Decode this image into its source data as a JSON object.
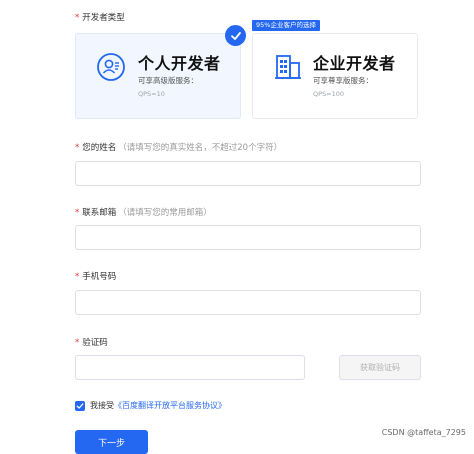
{
  "developer_type": {
    "label": "开发者类型",
    "required_mark": "*",
    "promo_tag": "95%企业客户的选择",
    "cards": [
      {
        "title": "个人开发者",
        "desc": "可享高级版服务：",
        "qps": "QPS=10",
        "icon": "person-icon",
        "selected": true
      },
      {
        "title": "企业开发者",
        "desc": "可享尊享版服务：",
        "qps": "QPS=100",
        "icon": "building-icon",
        "selected": false
      }
    ]
  },
  "form": {
    "name": {
      "label": "您的姓名",
      "hint": "（请填写您的真实姓名，不超过20个字符）",
      "value": ""
    },
    "email": {
      "label": "联系邮箱",
      "hint": "（请填写您的常用邮箱）",
      "value": ""
    },
    "phone": {
      "label": "手机号码",
      "value": ""
    },
    "code": {
      "label": "验证码",
      "value": "",
      "button": "获取验证码"
    }
  },
  "agreement": {
    "checked": true,
    "prefix": "我接受",
    "link": "《百度翻译开放平台服务协议》"
  },
  "submit_label": "下一步",
  "watermark": "CSDN @taffeta_7295",
  "colors": {
    "accent": "#2468f2",
    "required": "#e53935",
    "selected_card_bg": "#f2f7ff"
  }
}
